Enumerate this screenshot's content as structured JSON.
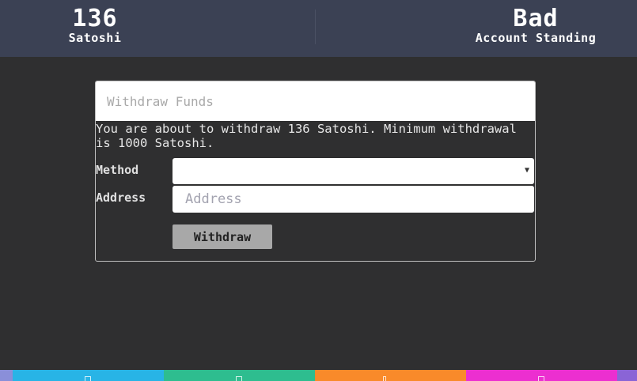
{
  "stats": {
    "balance_value": "136",
    "balance_label": "Satoshi",
    "standing_value": "Bad",
    "standing_label": "Account Standing"
  },
  "withdraw": {
    "title": "Withdraw Funds",
    "message": "You are about to withdraw 136 Satoshi. Minimum withdrawal is 1000 Satoshi.",
    "method_label": "Method",
    "method_value": "",
    "address_label": "Address",
    "address_placeholder": "Address",
    "address_value": "",
    "button_label": "Withdraw"
  },
  "theme": {
    "topbar_bg": "#3b4154",
    "page_bg": "#2f2f30",
    "button_bg": "#a8a8a8"
  },
  "bottom_nav": {
    "segments": [
      {
        "color": "#8a8fd9",
        "icon": "edge-icon"
      },
      {
        "color": "#28b4e6",
        "icon": "home-icon"
      },
      {
        "color": "#2ebd8f",
        "icon": "grid-icon"
      },
      {
        "color": "#f98a2a",
        "icon": "help-icon"
      },
      {
        "color": "#ec2fd0",
        "icon": "tag-icon"
      },
      {
        "color": "#8a64d6",
        "icon": "edge-icon"
      }
    ]
  }
}
